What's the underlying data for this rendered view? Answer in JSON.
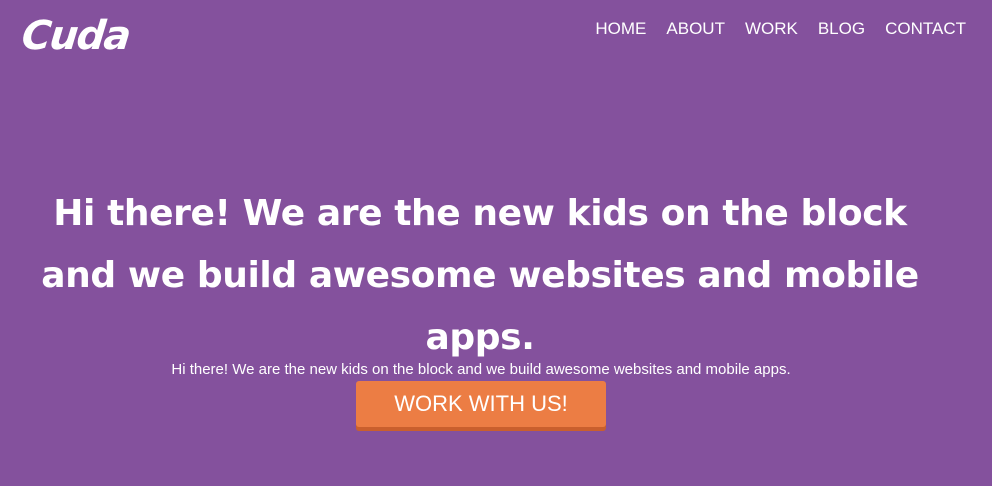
{
  "brand": {
    "logo_text": "Cuda"
  },
  "nav": {
    "items": [
      {
        "label": "HOME"
      },
      {
        "label": "ABOUT"
      },
      {
        "label": "WORK"
      },
      {
        "label": "BLOG"
      },
      {
        "label": "CONTACT"
      }
    ]
  },
  "hero": {
    "title": "Hi there! We are the new kids on the block and we build awesome websites and mobile apps.",
    "subtitle": "Hi there! We are the new kids on the block and we build awesome websites and mobile apps.",
    "cta_label": "WORK WITH US!"
  },
  "colors": {
    "background": "#84519d",
    "accent": "#ec7d44",
    "text": "#ffffff"
  }
}
